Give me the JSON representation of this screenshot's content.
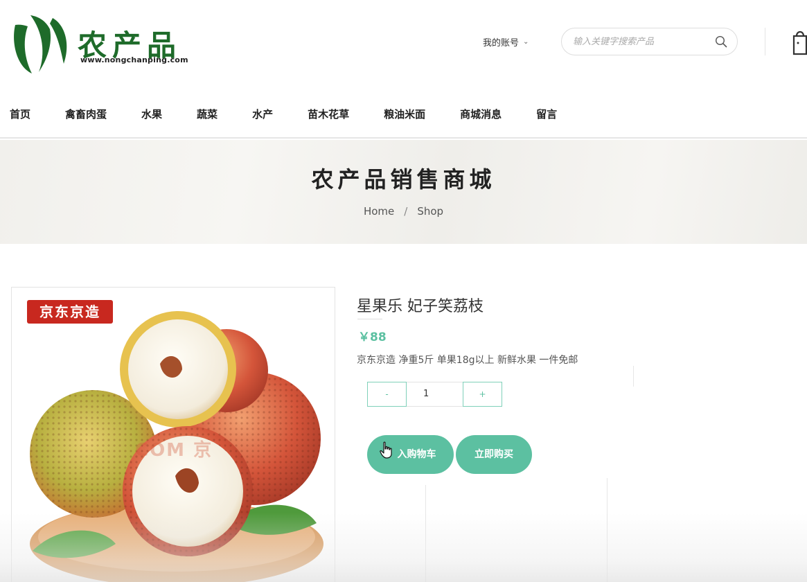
{
  "header": {
    "logo_text": "农产品",
    "logo_url": "www.nongchanping.com",
    "account_label": "我的账号",
    "search_placeholder": "输入关键字搜索产品"
  },
  "nav": {
    "items": [
      "首页",
      "禽畜肉蛋",
      "水果",
      "蔬菜",
      "水产",
      "苗木花草",
      "粮油米面",
      "商城消息",
      "留言"
    ]
  },
  "banner": {
    "title": "农产品销售商城",
    "breadcrumb": [
      "Home",
      "Shop"
    ]
  },
  "product": {
    "image_badge": "京东京造",
    "image_watermark": "COM 京",
    "name": "星果乐 妃子笑荔枝",
    "price": "￥88",
    "description": "京东京造 净重5斤 单果18g以上 新鲜水果 一件免邮",
    "quantity": "1",
    "minus_label": "-",
    "plus_label": "+",
    "add_to_cart_label": "入购物车",
    "buy_now_label": "立即购买"
  },
  "colors": {
    "accent": "#5cc0a1",
    "logo_green": "#1e6b2a",
    "badge_red": "#c8281f"
  },
  "icons": [
    "logo-leaf-icon",
    "chevron-down-icon",
    "search-icon",
    "shopping-bag-icon",
    "hand-cursor-icon"
  ]
}
